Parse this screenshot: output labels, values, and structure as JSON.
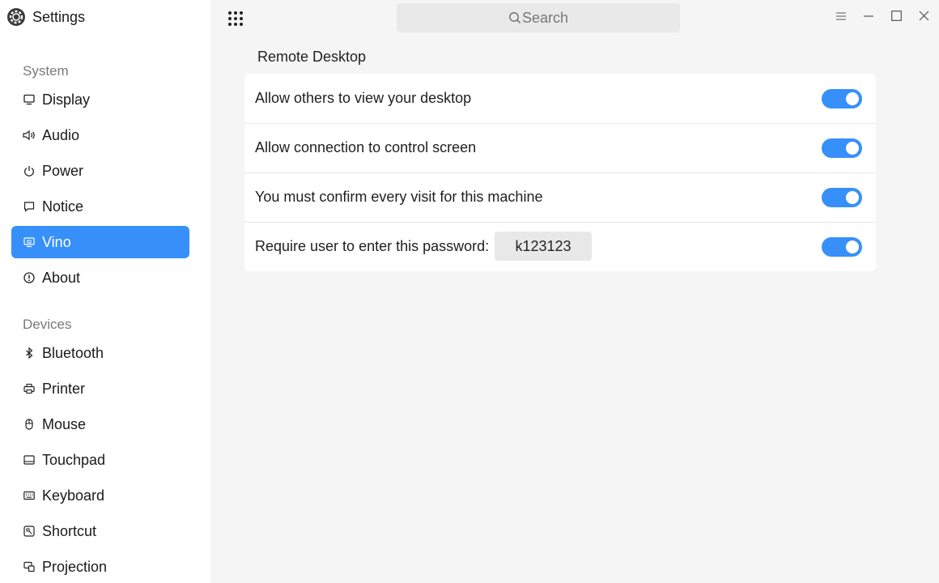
{
  "app": {
    "title": "Settings",
    "icon": "gear-icon"
  },
  "sidebar": {
    "groups": [
      {
        "title": "System"
      },
      {
        "title": "Devices"
      }
    ],
    "items": [
      {
        "label": "Display",
        "icon": "monitor-icon"
      },
      {
        "label": "Audio",
        "icon": "speaker-icon"
      },
      {
        "label": "Power",
        "icon": "power-icon"
      },
      {
        "label": "Notice",
        "icon": "message-icon"
      },
      {
        "label": "Vino",
        "icon": "remote-desktop-icon",
        "active": true
      },
      {
        "label": "About",
        "icon": "info-icon"
      },
      {
        "label": "Bluetooth",
        "icon": "bluetooth-icon"
      },
      {
        "label": "Printer",
        "icon": "printer-icon"
      },
      {
        "label": "Mouse",
        "icon": "mouse-icon"
      },
      {
        "label": "Touchpad",
        "icon": "touchpad-icon"
      },
      {
        "label": "Keyboard",
        "icon": "keyboard-icon"
      },
      {
        "label": "Shortcut",
        "icon": "shortcut-icon"
      },
      {
        "label": "Projection",
        "icon": "projection-icon"
      }
    ]
  },
  "topbar": {
    "search_placeholder": "Search"
  },
  "main": {
    "section_title": "Remote Desktop",
    "rows": [
      {
        "label": "Allow others to view your desktop",
        "enabled": true
      },
      {
        "label": "Allow connection to control screen",
        "enabled": true
      },
      {
        "label": "You must confirm every visit for this machine",
        "enabled": true
      },
      {
        "label": "Require user to enter this password:",
        "enabled": true,
        "password": "k123123"
      }
    ]
  },
  "colors": {
    "accent": "#3790fa",
    "sidebar_bg": "#ffffff",
    "content_bg": "#f5f5f5"
  }
}
